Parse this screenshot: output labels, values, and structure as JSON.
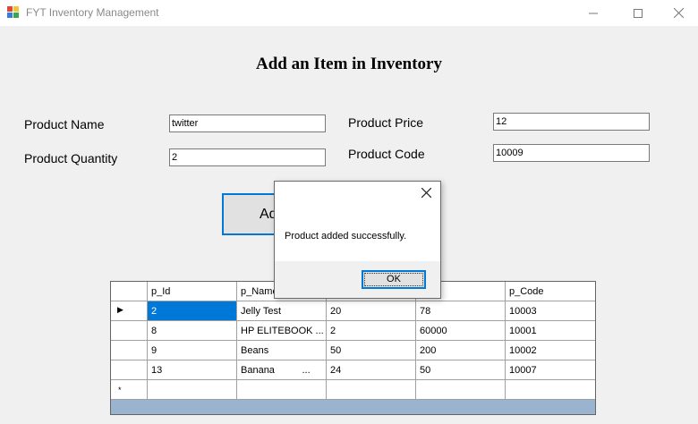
{
  "window": {
    "title": "FYT Inventory Management"
  },
  "form": {
    "heading": "Add an Item in Inventory",
    "product_name_label": "Product Name",
    "product_name_value": "twitter",
    "product_quantity_label": "Product Quantity",
    "product_quantity_value": "2",
    "product_price_label": "Product Price",
    "product_price_value": "12",
    "product_code_label": "Product Code",
    "product_code_value": "10009",
    "add_button_label": "Add"
  },
  "grid": {
    "columns": [
      "p_Id",
      "p_Name",
      "",
      "rice",
      "p_Code"
    ],
    "rows": [
      [
        "2",
        "Jelly Test",
        "20",
        "78",
        "10003"
      ],
      [
        "8",
        "HP ELITEBOOK ...",
        "2",
        "60000",
        "10001"
      ],
      [
        "9",
        "Beans",
        "50",
        "200",
        "10002"
      ],
      [
        "13",
        "Banana          ...",
        "24",
        "50",
        "10007"
      ]
    ],
    "current_row_marker": "▶",
    "new_row_marker": "*"
  },
  "dialog": {
    "message": "Product added successfully.",
    "ok_label": "OK"
  },
  "colors": {
    "accent": "#0078d7",
    "grid_background": "#9ab3cf",
    "window_background": "#f0f0f0"
  }
}
